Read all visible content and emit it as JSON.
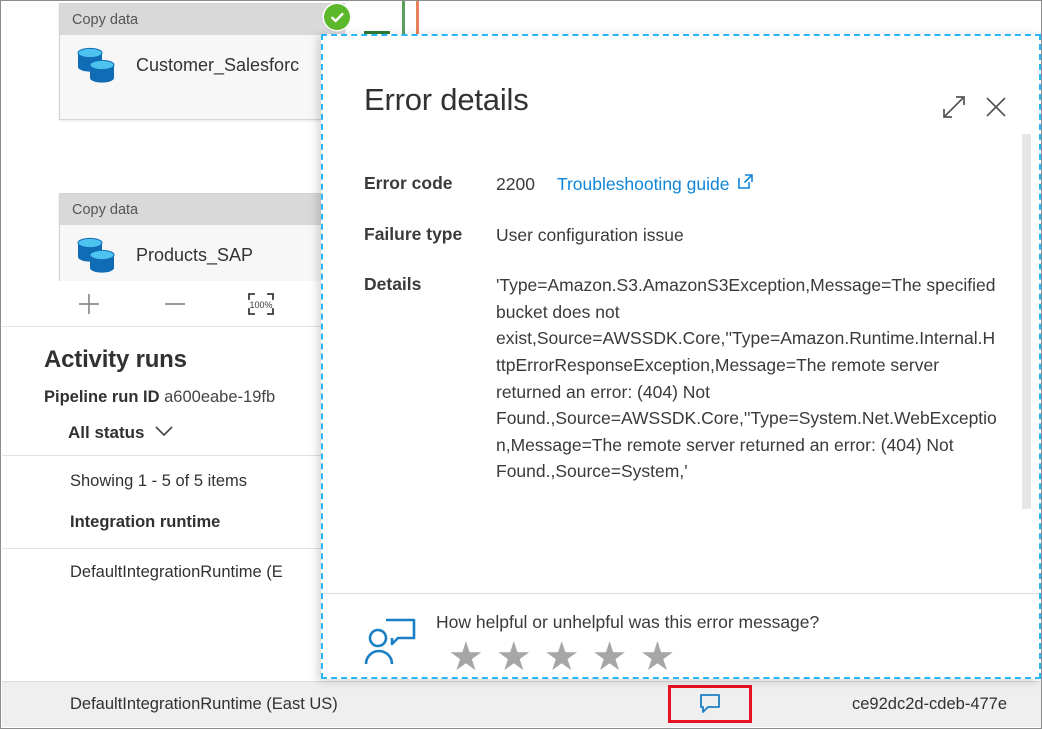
{
  "canvas": {
    "nodes": [
      {
        "header": "Copy data",
        "label": "Customer_Salesforc",
        "status_icon": "success-check-icon"
      },
      {
        "header": "Copy data",
        "label": "Products_SAP",
        "status_icon": "none"
      }
    ],
    "toolbar": [
      {
        "name": "zoom-in-button",
        "glyph": "plus"
      },
      {
        "name": "zoom-out-button",
        "glyph": "minus"
      },
      {
        "name": "zoom-to-100-button",
        "glyph": "100%"
      },
      {
        "name": "fit-to-screen-button",
        "glyph": "fit"
      }
    ]
  },
  "activity": {
    "title": "Activity runs",
    "pipeline_run_id_label": "Pipeline run ID",
    "pipeline_run_id_value": "a600eabe-19fb",
    "status_filter": "All status",
    "showing": "Showing 1 - 5 of 5 items",
    "column_header": "Integration runtime",
    "rows": [
      {
        "name": "DefaultIntegrationRuntime (E"
      }
    ],
    "selected_row": {
      "name": "DefaultIntegrationRuntime (East US)",
      "feedback_icon": "comment-icon",
      "run_id": "ce92dc2d-cdeb-477e"
    }
  },
  "panel": {
    "title": "Error details",
    "expand_icon": "expand-diagonal-icon",
    "close_icon": "close-icon",
    "fields": [
      {
        "label": "Error code",
        "value": "2200"
      },
      {
        "label": "Failure type",
        "value": "User configuration issue"
      },
      {
        "label": "Details",
        "value": "'Type=Amazon.S3.AmazonS3Exception,Message=The specified bucket does not exist,Source=AWSSDK.Core,''Type=Amazon.Runtime.Internal.HttpErrorResponseException,Message=The remote server returned an error: (404) Not Found.,Source=AWSSDK.Core,''Type=System.Net.WebException,Message=The remote server returned an error: (404) Not Found.,Source=System,'"
      }
    ],
    "troubleshooting_link": "Troubleshooting guide",
    "feedback": {
      "icon": "person-feedback-icon",
      "question": "How helpful or unhelpful was this error message?",
      "stars": [
        "★",
        "★",
        "★",
        "★",
        "★"
      ]
    }
  },
  "colors": {
    "accent_blue": "#0f85d8",
    "panel_border_cyan": "#29b6f6",
    "highlight_red": "#e81123",
    "success_green": "#5cb82b",
    "star_gray": "#a6a6a6"
  }
}
